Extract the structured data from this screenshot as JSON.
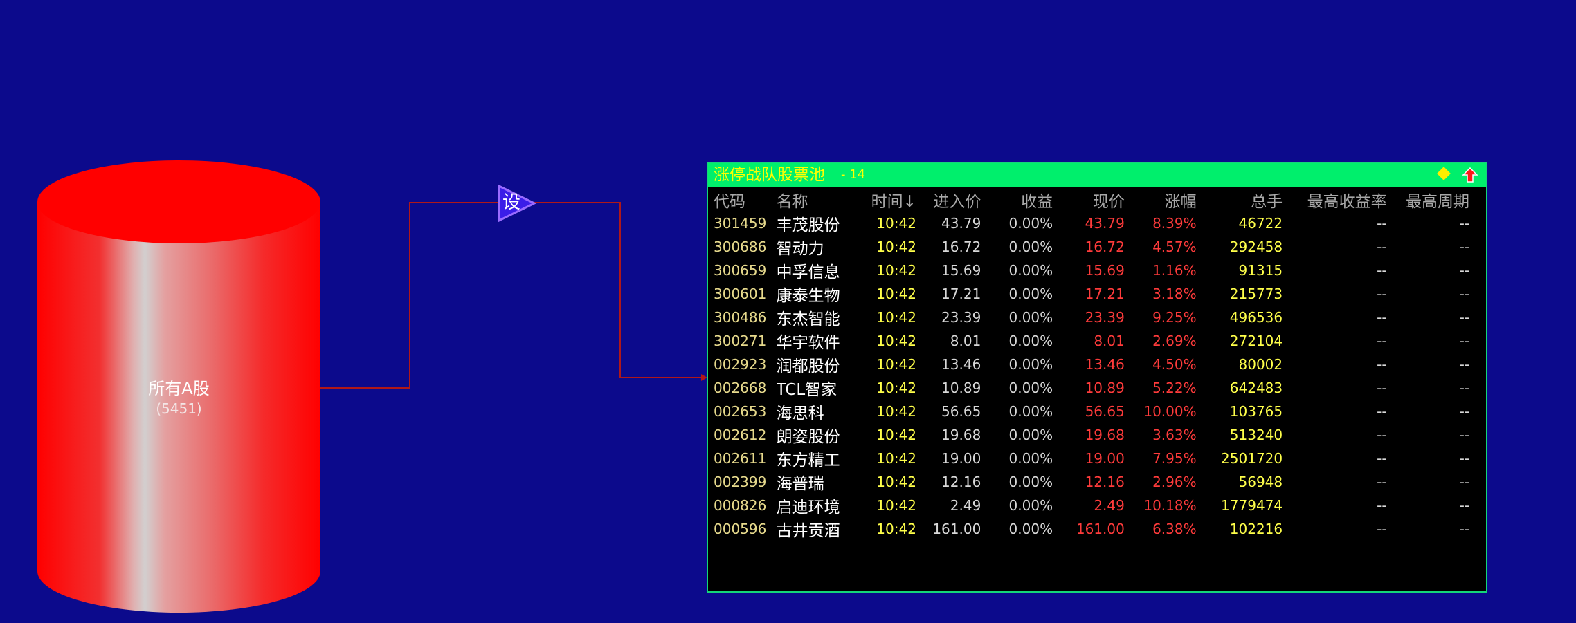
{
  "source_node": {
    "label": "所有A股",
    "count": "(5451)"
  },
  "filter_node": {
    "label": "设"
  },
  "result_panel": {
    "title": "涨停战队股票池",
    "count": "- 14",
    "colors": {
      "titlebar": "#00ef6c",
      "title_text": "#ffff00",
      "background": "#000000",
      "up_price": "#ff3b3b"
    },
    "columns": [
      "代码",
      "名称",
      "时间↓",
      "进入价",
      "收益",
      "现价",
      "涨幅",
      "总手",
      "最高收益率",
      "最高周期"
    ],
    "rows": [
      {
        "code": "301459",
        "name": "丰茂股份",
        "time": "10:42",
        "entry": "43.79",
        "gain": "0.00%",
        "price": "43.79",
        "change": "8.39%",
        "volume": "46722",
        "max_gain": "--",
        "max_period": "--"
      },
      {
        "code": "300686",
        "name": "智动力",
        "time": "10:42",
        "entry": "16.72",
        "gain": "0.00%",
        "price": "16.72",
        "change": "4.57%",
        "volume": "292458",
        "max_gain": "--",
        "max_period": "--"
      },
      {
        "code": "300659",
        "name": "中孚信息",
        "time": "10:42",
        "entry": "15.69",
        "gain": "0.00%",
        "price": "15.69",
        "change": "1.16%",
        "volume": "91315",
        "max_gain": "--",
        "max_period": "--"
      },
      {
        "code": "300601",
        "name": "康泰生物",
        "time": "10:42",
        "entry": "17.21",
        "gain": "0.00%",
        "price": "17.21",
        "change": "3.18%",
        "volume": "215773",
        "max_gain": "--",
        "max_period": "--"
      },
      {
        "code": "300486",
        "name": "东杰智能",
        "time": "10:42",
        "entry": "23.39",
        "gain": "0.00%",
        "price": "23.39",
        "change": "9.25%",
        "volume": "496536",
        "max_gain": "--",
        "max_period": "--"
      },
      {
        "code": "300271",
        "name": "华宇软件",
        "time": "10:42",
        "entry": "8.01",
        "gain": "0.00%",
        "price": "8.01",
        "change": "2.69%",
        "volume": "272104",
        "max_gain": "--",
        "max_period": "--"
      },
      {
        "code": "002923",
        "name": "润都股份",
        "time": "10:42",
        "entry": "13.46",
        "gain": "0.00%",
        "price": "13.46",
        "change": "4.50%",
        "volume": "80002",
        "max_gain": "--",
        "max_period": "--"
      },
      {
        "code": "002668",
        "name": "TCL智家",
        "time": "10:42",
        "entry": "10.89",
        "gain": "0.00%",
        "price": "10.89",
        "change": "5.22%",
        "volume": "642483",
        "max_gain": "--",
        "max_period": "--"
      },
      {
        "code": "002653",
        "name": "海思科",
        "time": "10:42",
        "entry": "56.65",
        "gain": "0.00%",
        "price": "56.65",
        "change": "10.00%",
        "volume": "103765",
        "max_gain": "--",
        "max_period": "--"
      },
      {
        "code": "002612",
        "name": "朗姿股份",
        "time": "10:42",
        "entry": "19.68",
        "gain": "0.00%",
        "price": "19.68",
        "change": "3.63%",
        "volume": "513240",
        "max_gain": "--",
        "max_period": "--"
      },
      {
        "code": "002611",
        "name": "东方精工",
        "time": "10:42",
        "entry": "19.00",
        "gain": "0.00%",
        "price": "19.00",
        "change": "7.95%",
        "volume": "2501720",
        "max_gain": "--",
        "max_period": "--"
      },
      {
        "code": "002399",
        "name": "海普瑞",
        "time": "10:42",
        "entry": "12.16",
        "gain": "0.00%",
        "price": "12.16",
        "change": "2.96%",
        "volume": "56948",
        "max_gain": "--",
        "max_period": "--"
      },
      {
        "code": "000826",
        "name": "启迪环境",
        "time": "10:42",
        "entry": "2.49",
        "gain": "0.00%",
        "price": "2.49",
        "change": "10.18%",
        "volume": "1779474",
        "max_gain": "--",
        "max_period": "--"
      },
      {
        "code": "000596",
        "name": "古井贡酒",
        "time": "10:42",
        "entry": "161.00",
        "gain": "0.00%",
        "price": "161.00",
        "change": "6.38%",
        "volume": "102216",
        "max_gain": "--",
        "max_period": "--"
      }
    ]
  },
  "icons": [
    "diamond-icon",
    "arrow-up-icon"
  ]
}
